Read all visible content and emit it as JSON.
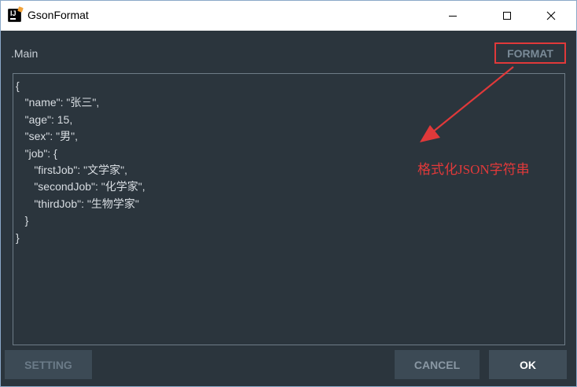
{
  "window": {
    "title": "GsonFormat"
  },
  "header": {
    "class_name": ".Main",
    "format_label": "FORMAT"
  },
  "editor": {
    "lines": [
      "{",
      "   \"name\": \"张三\",",
      "   \"age\": 15,",
      "   \"sex\": \"男\",",
      "   \"job\": {",
      "      \"firstJob\": \"文学家\",",
      "      \"secondJob\": \"化学家\",",
      "      \"thirdJob\": \"生物学家\"",
      "   }",
      "}"
    ]
  },
  "annotation": {
    "text": "格式化JSON字符串"
  },
  "footer": {
    "setting_label": "SETTING",
    "cancel_label": "CANCEL",
    "ok_label": "OK"
  },
  "colors": {
    "background": "#2b353d",
    "accent_red": "#e0393a",
    "button_bg": "#3c4a55"
  },
  "icons": {
    "app": "intellij-app-icon",
    "minimize": "minimize-icon",
    "maximize": "maximize-icon",
    "close": "close-icon",
    "arrow": "arrow-icon"
  }
}
